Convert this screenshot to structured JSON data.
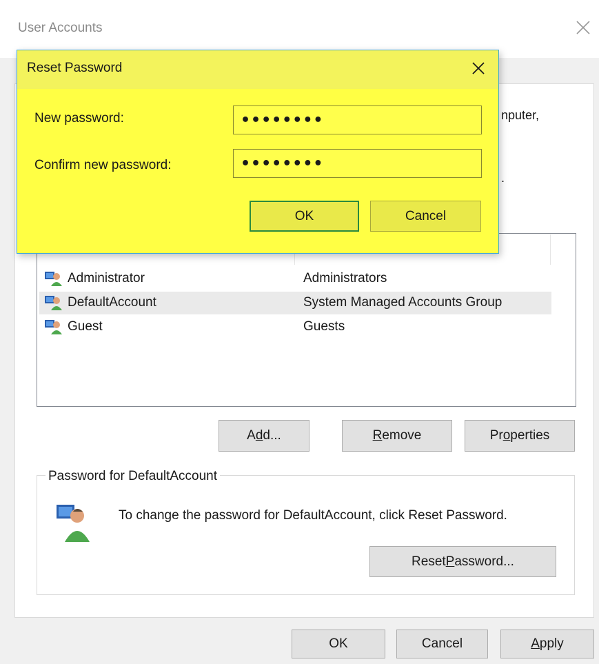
{
  "main_window": {
    "title": "User Accounts",
    "partial_text": {
      "line1": "nputer,",
      "line2": "."
    },
    "list": {
      "rows": [
        {
          "name": "Administrator",
          "group": "Administrators"
        },
        {
          "name": "DefaultAccount",
          "group": "System Managed Accounts Group"
        },
        {
          "name": "Guest",
          "group": "Guests"
        }
      ]
    },
    "buttons": {
      "add": {
        "pre": "A",
        "ul": "d",
        "post": "d..."
      },
      "remove": {
        "pre": "",
        "ul": "R",
        "post": "emove"
      },
      "properties": {
        "pre": "Pr",
        "ul": "o",
        "post": "perties"
      }
    },
    "password_group": {
      "label": "Password for DefaultAccount",
      "text": "To change the password for DefaultAccount, click Reset Password.",
      "reset_button": {
        "pre": "Reset ",
        "ul": "P",
        "post": "assword..."
      }
    },
    "footer": {
      "ok": "OK",
      "cancel": "Cancel",
      "apply": {
        "pre": "",
        "ul": "A",
        "post": "pply"
      }
    }
  },
  "reset_dialog": {
    "title": "Reset Password",
    "new_password_label": "New password:",
    "new_password_value": "••••••••",
    "confirm_password_label": "Confirm new password:",
    "confirm_password_value": "••••••••",
    "ok": "OK",
    "cancel": "Cancel",
    "colors": {
      "background": "#ffff44",
      "accent_border": "#41a8d6",
      "default_button_border": "#2b8a3e"
    }
  }
}
